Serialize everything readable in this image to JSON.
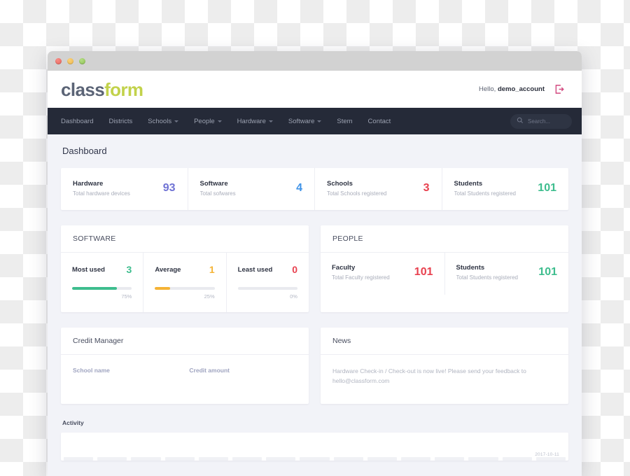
{
  "window": {
    "traffic_lights": [
      "close",
      "minimize",
      "maximize"
    ]
  },
  "brand": {
    "logo_first": "class",
    "logo_second": "form",
    "greeting_prefix": "Hello,",
    "account_name": "demo_account",
    "logout_icon": "logout-icon",
    "colors": {
      "logo_dark": "#5b6476",
      "logo_green": "#c2d24b",
      "logout": "#d2487f"
    }
  },
  "nav": {
    "items": [
      {
        "label": "Dashboard",
        "has_caret": false
      },
      {
        "label": "Districts",
        "has_caret": false
      },
      {
        "label": "Schools",
        "has_caret": true
      },
      {
        "label": "People",
        "has_caret": true
      },
      {
        "label": "Hardware",
        "has_caret": true
      },
      {
        "label": "Software",
        "has_caret": true
      },
      {
        "label": "Stem",
        "has_caret": false
      },
      {
        "label": "Contact",
        "has_caret": false
      }
    ],
    "search": {
      "placeholder": "Search...",
      "icon": "search-icon"
    },
    "bg_color": "#252a38"
  },
  "page": {
    "title": "Dashboard"
  },
  "stats": [
    {
      "title": "Hardware",
      "subtitle": "Total hardware devices",
      "value": "93",
      "color": "#6f72d4"
    },
    {
      "title": "Software",
      "subtitle": "Total sofwares",
      "value": "4",
      "color": "#3f93e8"
    },
    {
      "title": "Schools",
      "subtitle": "Total Schools registered",
      "value": "3",
      "color": "#e8414f"
    },
    {
      "title": "Students",
      "subtitle": "Total Students registered",
      "value": "101",
      "color": "#3ebd8e"
    }
  ],
  "software_panel": {
    "heading": "SOFTWARE",
    "items": [
      {
        "label": "Most used",
        "value": "3",
        "percent_label": "75%",
        "percent": 75,
        "color": "#3ebd8e"
      },
      {
        "label": "Average",
        "value": "1",
        "percent_label": "25%",
        "percent": 25,
        "color": "#f5b335"
      },
      {
        "label": "Least used",
        "value": "0",
        "percent_label": "0%",
        "percent": 0,
        "color": "#e8414f"
      }
    ]
  },
  "people_panel": {
    "heading": "PEOPLE",
    "items": [
      {
        "title": "Faculty",
        "subtitle": "Total Faculty registered",
        "value": "101",
        "color": "#e8414f"
      },
      {
        "title": "Students",
        "subtitle": "Total Students registered",
        "value": "101",
        "color": "#3ebd8e"
      }
    ]
  },
  "credit_manager": {
    "heading": "Credit Manager",
    "columns": [
      "School name",
      "Credit amount"
    ],
    "rows": []
  },
  "news": {
    "heading": "News",
    "body": "Hardware Check-in / Check-out is now live! Please send your feedback to hello@classform.com"
  },
  "activity": {
    "heading": "Activity",
    "date": "2017-10-11",
    "bar_count": 15
  }
}
